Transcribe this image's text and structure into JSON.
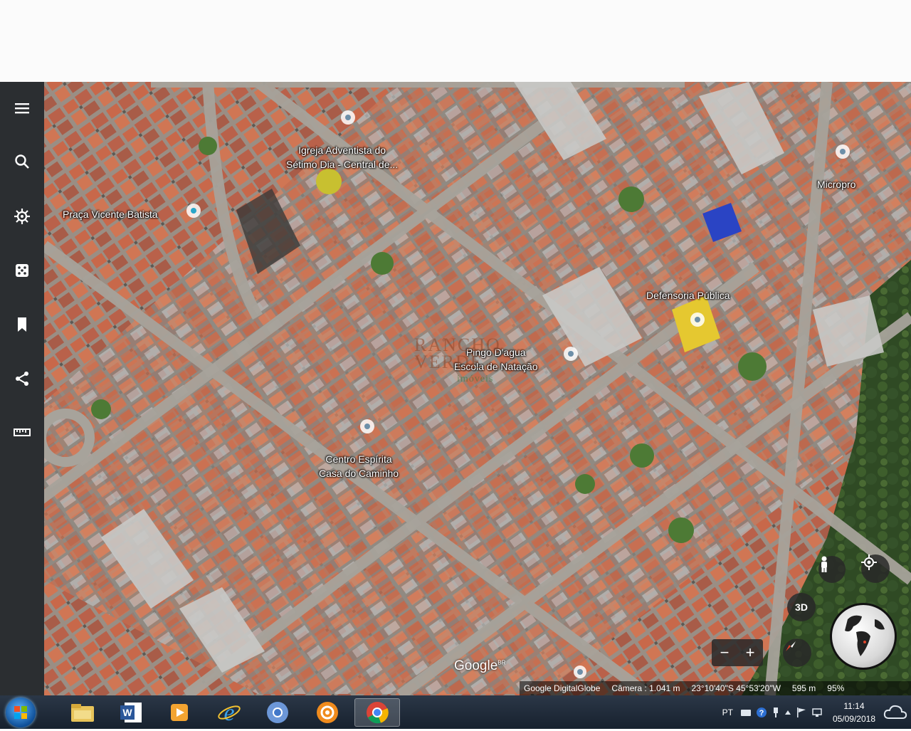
{
  "places": [
    {
      "name": "Igreja Adventista do\nSétimo Dia - Central de..."
    },
    {
      "name": "Praça Vicente Batista"
    },
    {
      "name": "Micropro"
    },
    {
      "name": "Defensoria Pública"
    },
    {
      "name": "Pingo D'agua\nEscola de Natação"
    },
    {
      "name": "Centro Espírita\nCasa do Caminho"
    }
  ],
  "watermark": {
    "line1": "RANCHO",
    "line2": "VERDE",
    "line3": "imóveis"
  },
  "map_logo": {
    "text": "Google",
    "suffix": "BR"
  },
  "attribution": {
    "provider": "Google DigitalGlobe",
    "camera": "Câmera : 1.041 m",
    "coords": "23°10'40\"S 45°53'20\"W",
    "elevation": "595 m",
    "percent": "95%"
  },
  "controls": {
    "mode_3d": "3D",
    "zoom_out": "−",
    "zoom_in": "+"
  },
  "sidebar_icons": [
    "menu-icon",
    "search-icon",
    "voyager-icon",
    "dice-icon",
    "bookmark-icon",
    "share-icon",
    "ruler-icon"
  ],
  "taskbar": {
    "apps": [
      "file-explorer-icon",
      "word-icon",
      "media-player-icon",
      "internet-explorer-icon",
      "chromium-icon",
      "settings-app-icon",
      "chrome-icon"
    ],
    "language": "PT",
    "time": "11:14",
    "date": "05/09/2018"
  }
}
